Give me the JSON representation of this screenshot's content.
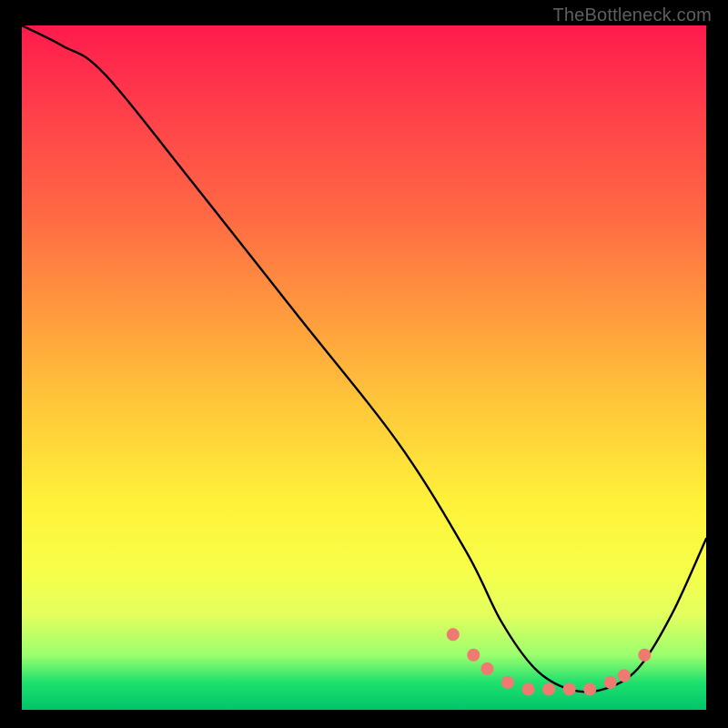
{
  "watermark": "TheBottleneck.com",
  "chart_data": {
    "type": "line",
    "title": "",
    "xlabel": "",
    "ylabel": "",
    "xlim": [
      0,
      100
    ],
    "ylim": [
      0,
      100
    ],
    "grid": false,
    "legend": false,
    "note": "Heat-gradient background from red (top / high bottleneck) to green (bottom / low bottleneck). Black curve descends from upper-left, reaches a flat minimum near x≈70–85, then rises toward the right. Salmon dots cluster around the minimum.",
    "series": [
      {
        "name": "curve",
        "color": "#000000",
        "x": [
          0,
          6,
          12,
          25,
          40,
          55,
          65,
          70,
          75,
          80,
          85,
          90,
          95,
          100
        ],
        "y": [
          100,
          97,
          93,
          77,
          58,
          39,
          23,
          13,
          6,
          3,
          3,
          6,
          14,
          25
        ]
      }
    ],
    "points": {
      "name": "highlight-dots",
      "color": "#ef7a72",
      "radius": 7,
      "x": [
        63,
        66,
        68,
        71,
        74,
        77,
        80,
        83,
        86,
        88,
        91
      ],
      "y": [
        11,
        8,
        6,
        4,
        3,
        3,
        3,
        3,
        4,
        5,
        8
      ]
    }
  }
}
